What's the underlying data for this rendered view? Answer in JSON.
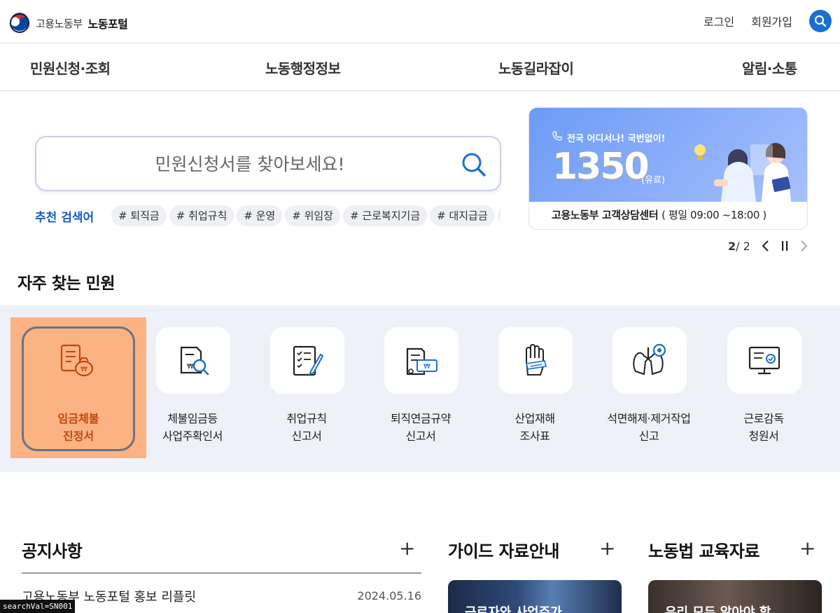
{
  "header": {
    "org_name": "고용노동부",
    "portal_name": "노동포털",
    "login": "로그인",
    "signup": "회원가입"
  },
  "gnb": [
    "민원신청·조회",
    "노동행정정보",
    "노동길라잡이",
    "알림·소통"
  ],
  "search": {
    "placeholder": "민원신청서를 찾아보세요!",
    "recommend_label": "추천 검색어",
    "tags": [
      "# 퇴직금",
      "# 취업규칙",
      "# 운영",
      "# 위임장",
      "# 근로복지기금",
      "# 대지급금",
      "#"
    ]
  },
  "banner": {
    "slogan": "전국 어디서나! 국번없이!",
    "phone": "1350",
    "phone_note": "(유료)",
    "center_name": "고용노동부 고객상담센터",
    "hours": "( 평일 09:00 ~18:00 )",
    "current": "2",
    "total": "/ 2"
  },
  "frequent": {
    "title": "자주 찾는 민원",
    "items": [
      {
        "line1": "임금체불",
        "line2": "진정서",
        "icon": "wage-bag-icon"
      },
      {
        "line1": "체불임금등",
        "line2": "사업주확인서",
        "icon": "document-search-icon"
      },
      {
        "line1": "취업규칙",
        "line2": "신고서",
        "icon": "checklist-pen-icon"
      },
      {
        "line1": "퇴직연금규약",
        "line2": "신고서",
        "icon": "pension-document-icon"
      },
      {
        "line1": "산업재해",
        "line2": "조사표",
        "icon": "injured-hand-icon"
      },
      {
        "line1": "석면해제·제거작업",
        "line2": "신고",
        "icon": "lungs-icon"
      },
      {
        "line1": "근로감독",
        "line2": "청원서",
        "icon": "monitor-check-icon"
      }
    ]
  },
  "sections": {
    "notice_title": "공지사항",
    "guide_title": "가이드 자료안내",
    "edu_title": "노동법 교육자료",
    "plus": "+",
    "notice_items": [
      {
        "title": "고용노동부 노동포털 홍보 리플릿",
        "date": "2024.05.16"
      }
    ],
    "guide_thumb_text": "근로자와 사업주가",
    "edu_thumb_text": "우리 모두 알아야 할"
  },
  "status": "searchVal=SN001",
  "colors": {
    "accent_blue": "#1a6fd0",
    "recommend_blue": "#1a5bbf",
    "highlight_orange": "#fbb383",
    "band_bg": "#eef1f8",
    "banner_blue": "#6c9bf5"
  }
}
